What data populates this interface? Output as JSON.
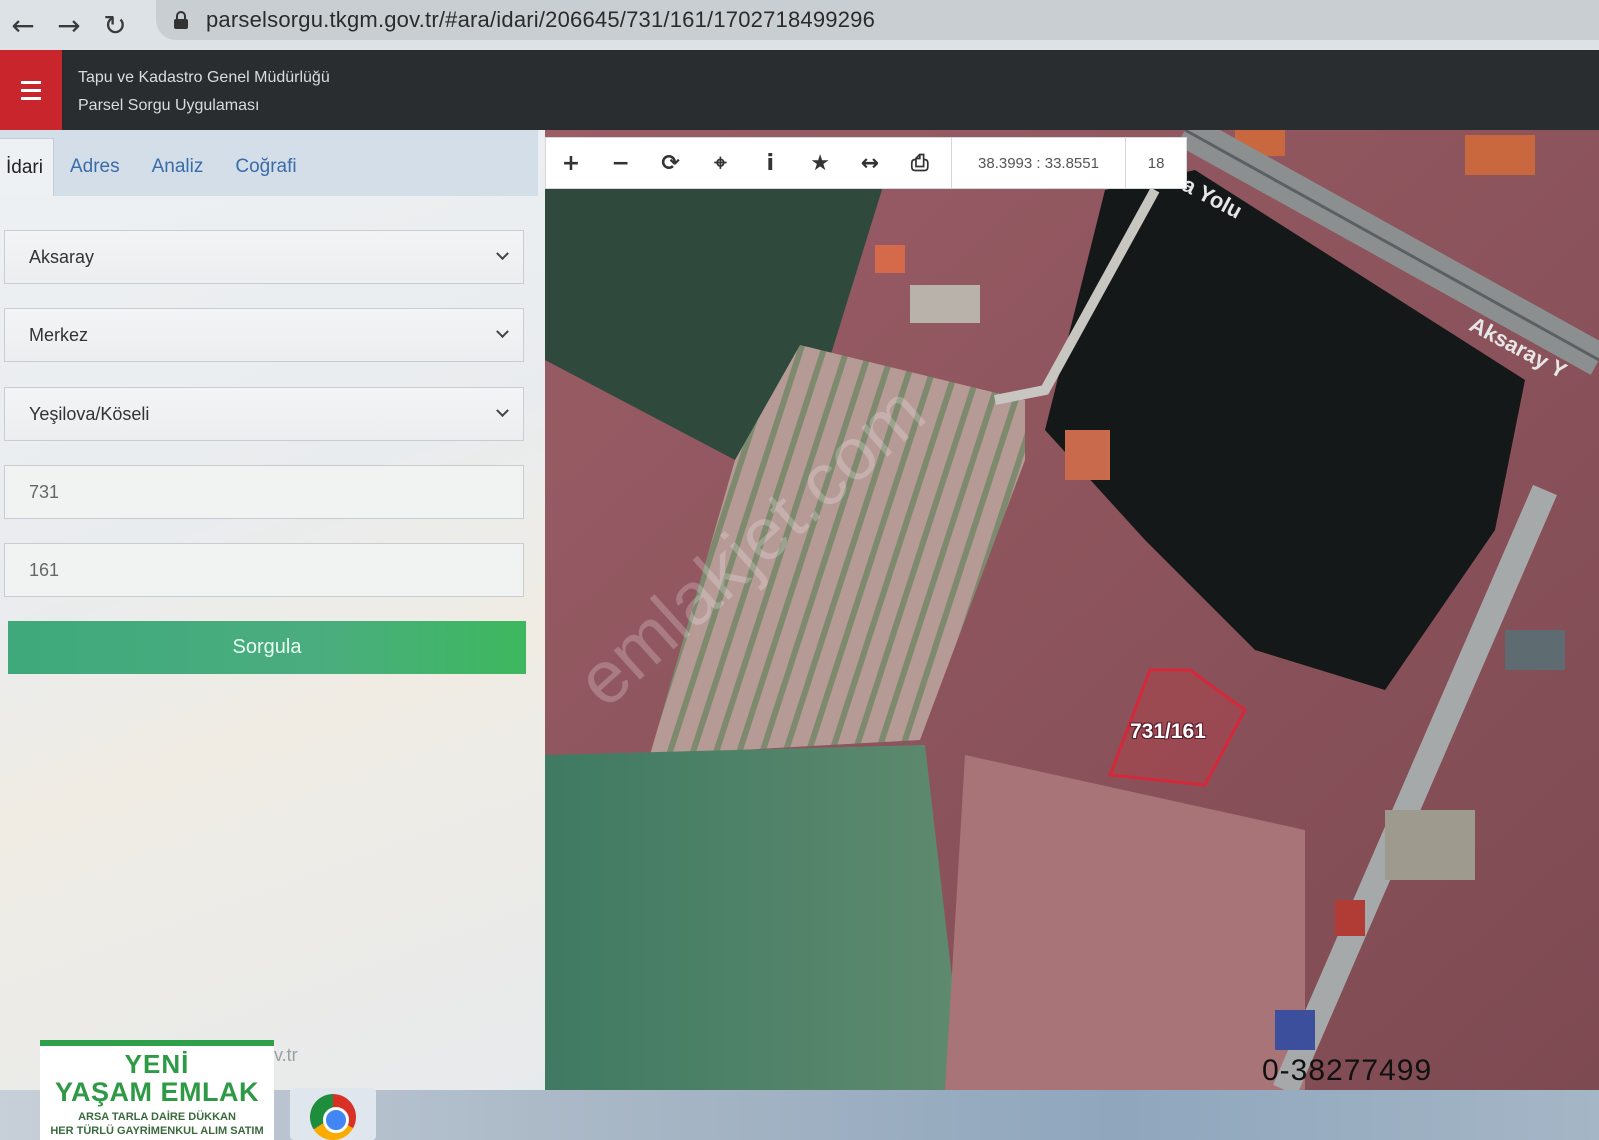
{
  "browser": {
    "back_glyph": "←",
    "forward_glyph": "→",
    "reload_glyph": "↻",
    "url": "parselsorgu.tkgm.gov.tr/#ara/idari/206645/731/161/1702718499296"
  },
  "header": {
    "title_line1": "Tapu ve Kadastro Genel Müdürlüğü",
    "title_line2": "Parsel Sorgu Uygulaması"
  },
  "sidebar": {
    "tabs": [
      "İdari",
      "Adres",
      "Analiz",
      "Coğrafi"
    ],
    "province": "Aksaray",
    "district": "Merkez",
    "neighborhood": "Yeşilova/Köseli",
    "block": "731",
    "parcel": "161",
    "submit_label": "Sorgula",
    "footer": "m.gov.tr"
  },
  "toolbar": {
    "zoom_in": "+",
    "zoom_out": "−",
    "refresh": "⟳",
    "locate": "⌖",
    "info": "i",
    "favorite": "★",
    "measure": "↔",
    "print": "⎙",
    "coordinates": "38.3993 : 33.8551",
    "zoom_level": "18"
  },
  "map": {
    "parcel_label": "731/161",
    "road_label_1": "a Yolu",
    "road_label_2": "Aksaray Y",
    "watermark": "emlakjet.com"
  },
  "overlay": {
    "logo_line1": "YENİ",
    "logo_line2": "YAŞAM EMLAK",
    "logo_line3": "ARSA  TARLA  DAİRE  DÜKKAN",
    "logo_line4": "HER TÜRLÜ GAYRİMENKUL ALIM SATIM",
    "phone": "0-38277499"
  },
  "colors": {
    "brand_red": "#c8262c",
    "header_dark": "#2a2d30",
    "button_green": "#45aa7d",
    "tab_blue": "#3a6ca8"
  }
}
